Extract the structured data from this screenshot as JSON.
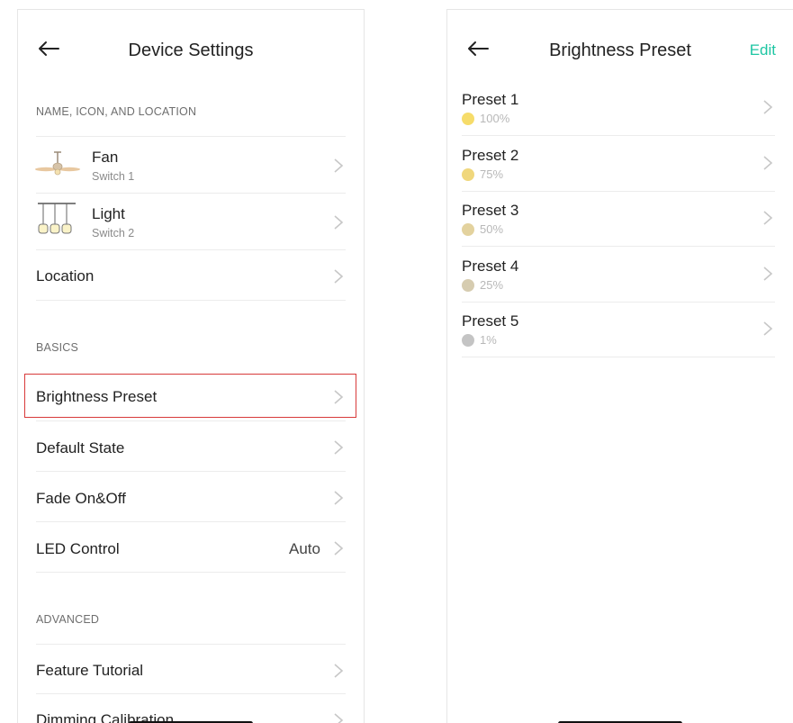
{
  "left": {
    "title": "Device Settings",
    "section_name": "NAME, ICON, AND LOCATION",
    "fan": {
      "label": "Fan",
      "sub": "Switch 1"
    },
    "light": {
      "label": "Light",
      "sub": "Switch 2"
    },
    "location": "Location",
    "section_basics": "BASICS",
    "brightness_preset": "Brightness Preset",
    "default_state": "Default State",
    "fade": "Fade On&Off",
    "led_control": {
      "label": "LED Control",
      "value": "Auto"
    },
    "section_advanced": "ADVANCED",
    "feature_tutorial": "Feature Tutorial",
    "dimming_calibration": "Dimming Calibration"
  },
  "right": {
    "title": "Brightness Preset",
    "edit": "Edit",
    "presets": [
      {
        "name": "Preset 1",
        "percent": "100%",
        "color": "#f6dc6a"
      },
      {
        "name": "Preset 2",
        "percent": "75%",
        "color": "#f0d77c"
      },
      {
        "name": "Preset 3",
        "percent": "50%",
        "color": "#e3d29e"
      },
      {
        "name": "Preset 4",
        "percent": "25%",
        "color": "#d6ccb0"
      },
      {
        "name": "Preset 5",
        "percent": "1%",
        "color": "#c4c4c4"
      }
    ]
  },
  "colors": {
    "accent": "#1ec6a3",
    "highlight": "#d83a3a"
  }
}
